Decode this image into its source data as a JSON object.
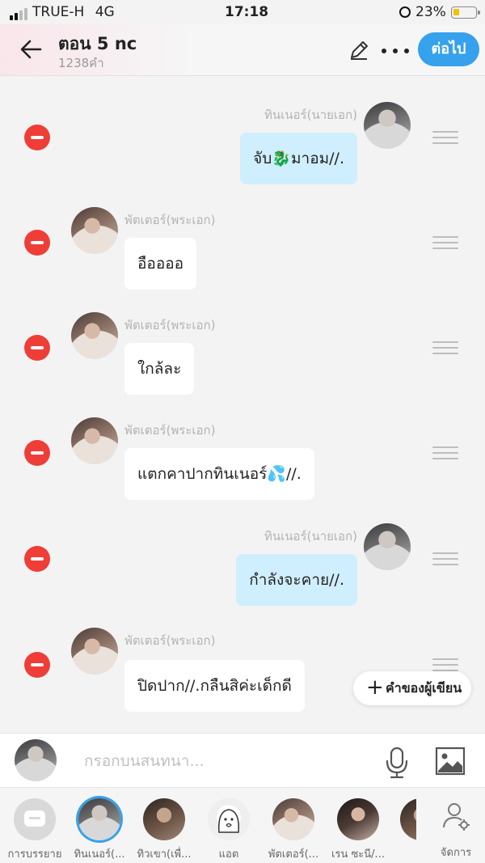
{
  "status_bar": {
    "carrier": "TRUE-H",
    "network": "4G",
    "time": "17:18",
    "battery": "23%"
  },
  "header": {
    "title": "ตอน 5 nc",
    "subtitle": "1238คำ",
    "next_label": "ต่อไป",
    "accent_color": "#36a1ec"
  },
  "messages": [
    {
      "speaker": "ทินเนอร์(นายเอก)",
      "text": "จับ🐉มาอม//.",
      "side": "right"
    },
    {
      "speaker": "พัตเตอร์(พระเอก)",
      "text": "อืออออ",
      "side": "left"
    },
    {
      "speaker": "พัตเตอร์(พระเอก)",
      "text": "ใกล้ละ",
      "side": "left"
    },
    {
      "speaker": "พัตเตอร์(พระเอก)",
      "text": "แตกคาปากทินเนอร์💦//.",
      "side": "left"
    },
    {
      "speaker": "ทินเนอร์(นายเอก)",
      "text": "กำลังจะคาย//.",
      "side": "right"
    },
    {
      "speaker": "พัตเตอร์(พระเอก)",
      "text": "ปิดปาก//.กลืนสิค่ะเด็กดี",
      "side": "left"
    }
  ],
  "narrator_button": "คำของผู้เขียน",
  "input": {
    "placeholder": "กรอกบนสนทนา..."
  },
  "characters": [
    {
      "label": "การบรรยาย"
    },
    {
      "label": "ทินเนอร์(..."
    },
    {
      "label": "ทิวเขา(เพื่..."
    },
    {
      "label": "แอต"
    },
    {
      "label": "พัตเตอร์(..."
    },
    {
      "label": "เรน ซะนี/..."
    }
  ],
  "manage_label": "จัดการ",
  "icons": {
    "back": "arrow-left-icon",
    "edit": "pencil-icon",
    "more": "more-dots-icon",
    "delete": "minus-circle-icon",
    "drag": "drag-handle-icon",
    "mic": "microphone-icon",
    "image": "image-icon",
    "manage": "user-gear-icon"
  },
  "colors": {
    "delete": "#ee3e37",
    "bubble_right": "#cfeefe",
    "bubble_left": "#ffffff"
  }
}
